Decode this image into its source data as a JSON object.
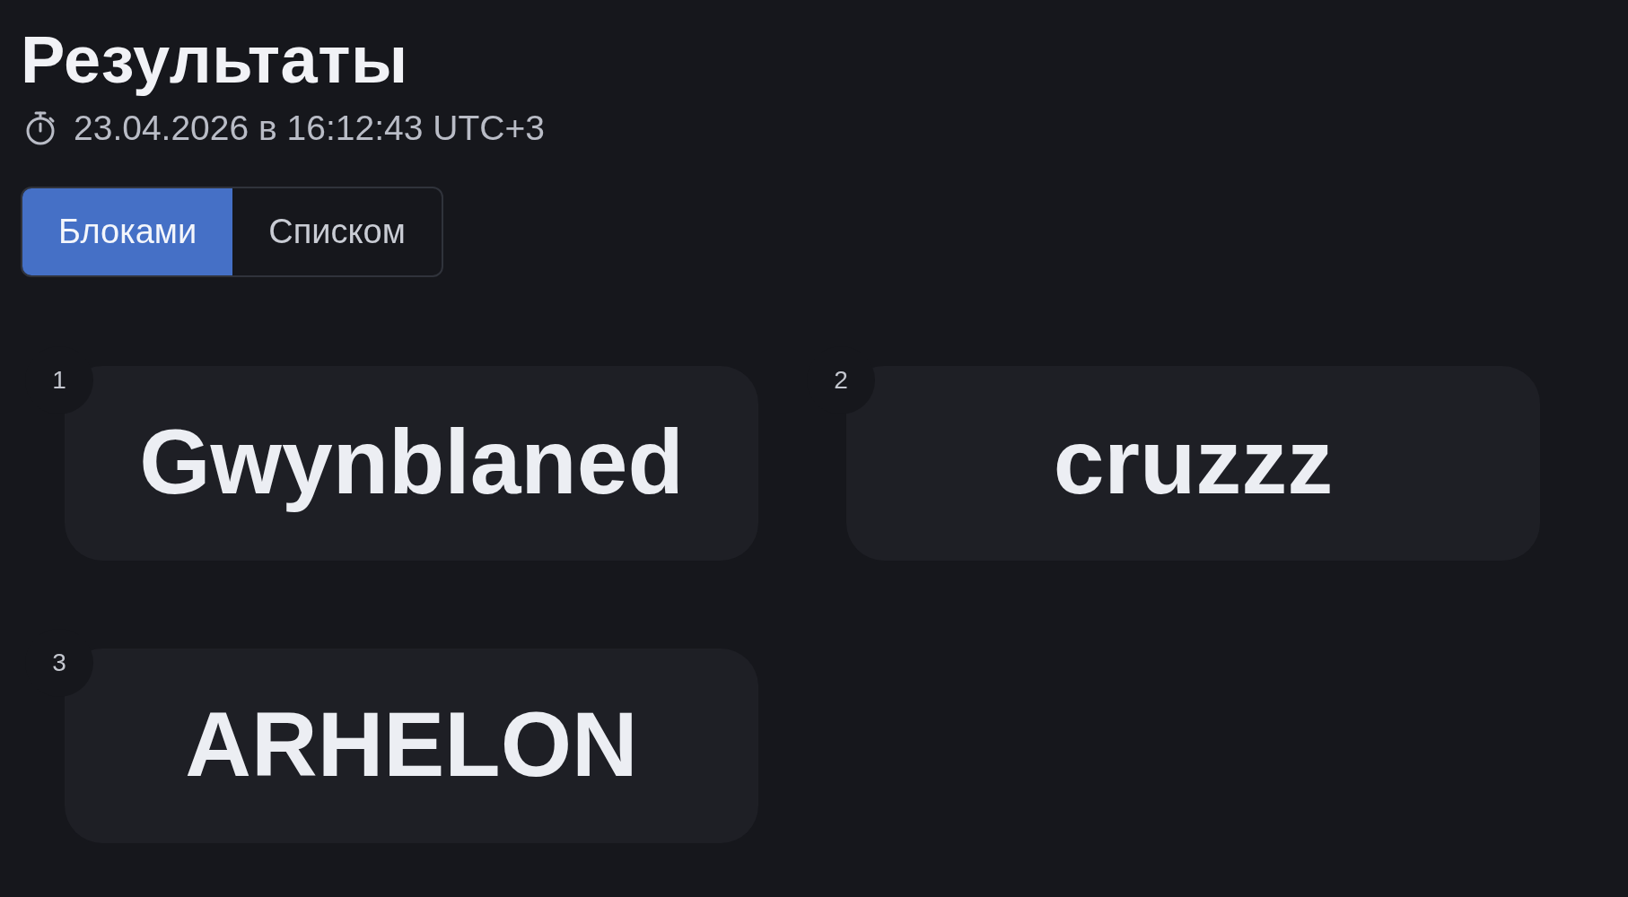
{
  "header": {
    "title": "Результаты",
    "timestamp": "23.04.2026 в 16:12:43 UTC+3"
  },
  "view_toggle": [
    {
      "label": "Блоками",
      "selected": true
    },
    {
      "label": "Списком",
      "selected": false
    }
  ],
  "results": [
    {
      "rank": "1",
      "name": "Gwynblaned"
    },
    {
      "rank": "2",
      "name": "cruzzz"
    },
    {
      "rank": "3",
      "name": "ARHELON"
    }
  ]
}
